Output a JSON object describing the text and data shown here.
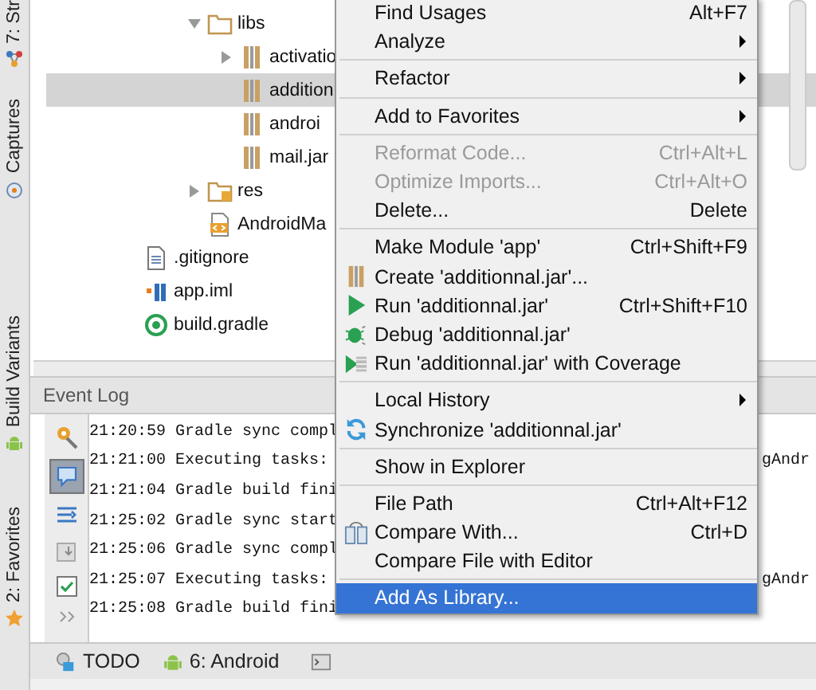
{
  "side_tabs": [
    {
      "label": "7: Str"
    },
    {
      "label": "Captures"
    },
    {
      "label": "Build Variants"
    },
    {
      "label": "2: Favorites"
    }
  ],
  "tree": {
    "inner_items": [
      {
        "label": "libs",
        "kind": "folder",
        "expanded": true,
        "selected": false,
        "children": [
          {
            "label": "activatio",
            "kind": "jar",
            "expandable": true,
            "selected": false
          },
          {
            "label": "addition",
            "kind": "jar",
            "expandable": false,
            "selected": true
          },
          {
            "label": "androi",
            "kind": "jar",
            "expandable": false,
            "selected": false
          },
          {
            "label": "mail.jar",
            "kind": "jar",
            "expandable": false,
            "selected": false
          }
        ]
      },
      {
        "label": "res",
        "kind": "res",
        "expanded": false,
        "selected": false
      },
      {
        "label": "AndroidMa",
        "kind": "manifest",
        "selected": false
      }
    ],
    "items": [
      {
        "label": ".gitignore",
        "kind": "text",
        "selected": false
      },
      {
        "label": "app.iml",
        "kind": "iml",
        "selected": false
      },
      {
        "label": "build.gradle",
        "kind": "gradle",
        "selected": false
      }
    ]
  },
  "event_log": {
    "title": "Event Log",
    "lines": [
      {
        "text": "21:20:59 Gradle sync compl"
      },
      {
        "text": "21:21:00 Executing tasks:",
        "tail": "gAndr"
      },
      {
        "text": "21:21:04 Gradle build fini"
      },
      {
        "text": "21:25:02 Gradle sync start"
      },
      {
        "text": "21:25:06 Gradle sync compl"
      },
      {
        "text": "21:25:07 Executing tasks:",
        "tail": "gAndr"
      },
      {
        "text": "21:25:08 Gradle build fini"
      }
    ]
  },
  "bottom_tabs": [
    {
      "label": "TODO",
      "kind": "todo"
    },
    {
      "label": "6: Android",
      "kind": "android"
    }
  ],
  "context_menu": [
    {
      "kind": "plain",
      "label": "Find Usages",
      "shortcut": "Alt+F7",
      "disabled": false,
      "submenu": false,
      "selected": false
    },
    {
      "kind": "plain",
      "label": "Analyze",
      "disabled": false,
      "submenu": true,
      "selected": false
    },
    {
      "kind": "separator"
    },
    {
      "kind": "plain",
      "label": "Refactor",
      "disabled": false,
      "submenu": true,
      "selected": false
    },
    {
      "kind": "separator"
    },
    {
      "kind": "plain",
      "label": "Add to Favorites",
      "disabled": false,
      "submenu": true,
      "selected": false
    },
    {
      "kind": "separator"
    },
    {
      "kind": "plain",
      "label": "Reformat Code...",
      "shortcut": "Ctrl+Alt+L",
      "disabled": true,
      "submenu": false,
      "selected": false
    },
    {
      "kind": "plain",
      "label": "Optimize Imports...",
      "shortcut": "Ctrl+Alt+O",
      "disabled": true,
      "submenu": false,
      "selected": false
    },
    {
      "kind": "plain",
      "label": "Delete...",
      "shortcut": "Delete",
      "disabled": false,
      "submenu": false,
      "selected": false
    },
    {
      "kind": "separator"
    },
    {
      "kind": "plain",
      "label": "Make Module 'app'",
      "shortcut": "Ctrl+Shift+F9",
      "disabled": false,
      "submenu": false,
      "selected": false
    },
    {
      "kind": "create",
      "label": "Create 'additionnal.jar'...",
      "disabled": false,
      "submenu": false,
      "selected": false
    },
    {
      "kind": "run",
      "label": "Run 'additionnal.jar'",
      "shortcut": "Ctrl+Shift+F10",
      "disabled": false,
      "submenu": false,
      "selected": false
    },
    {
      "kind": "debug",
      "label": "Debug 'additionnal.jar'",
      "disabled": false,
      "submenu": false,
      "selected": false
    },
    {
      "kind": "coverage",
      "label": "Run 'additionnal.jar' with Coverage",
      "disabled": false,
      "submenu": false,
      "selected": false
    },
    {
      "kind": "separator"
    },
    {
      "kind": "plain",
      "label": "Local History",
      "disabled": false,
      "submenu": true,
      "selected": false
    },
    {
      "kind": "sync",
      "label": "Synchronize 'additionnal.jar'",
      "disabled": false,
      "submenu": false,
      "selected": false
    },
    {
      "kind": "separator"
    },
    {
      "kind": "plain",
      "label": "Show in Explorer",
      "disabled": false,
      "submenu": false,
      "selected": false
    },
    {
      "kind": "separator"
    },
    {
      "kind": "plain",
      "label": "File Path",
      "shortcut": "Ctrl+Alt+F12",
      "disabled": false,
      "submenu": false,
      "selected": false
    },
    {
      "kind": "compare",
      "label": "Compare With...",
      "shortcut": "Ctrl+D",
      "disabled": false,
      "submenu": false,
      "selected": false
    },
    {
      "kind": "plain",
      "label": "Compare File with Editor",
      "disabled": false,
      "submenu": false,
      "selected": false
    },
    {
      "kind": "separator"
    },
    {
      "kind": "plain",
      "label": "Add As Library...",
      "disabled": false,
      "submenu": false,
      "selected": true
    }
  ]
}
